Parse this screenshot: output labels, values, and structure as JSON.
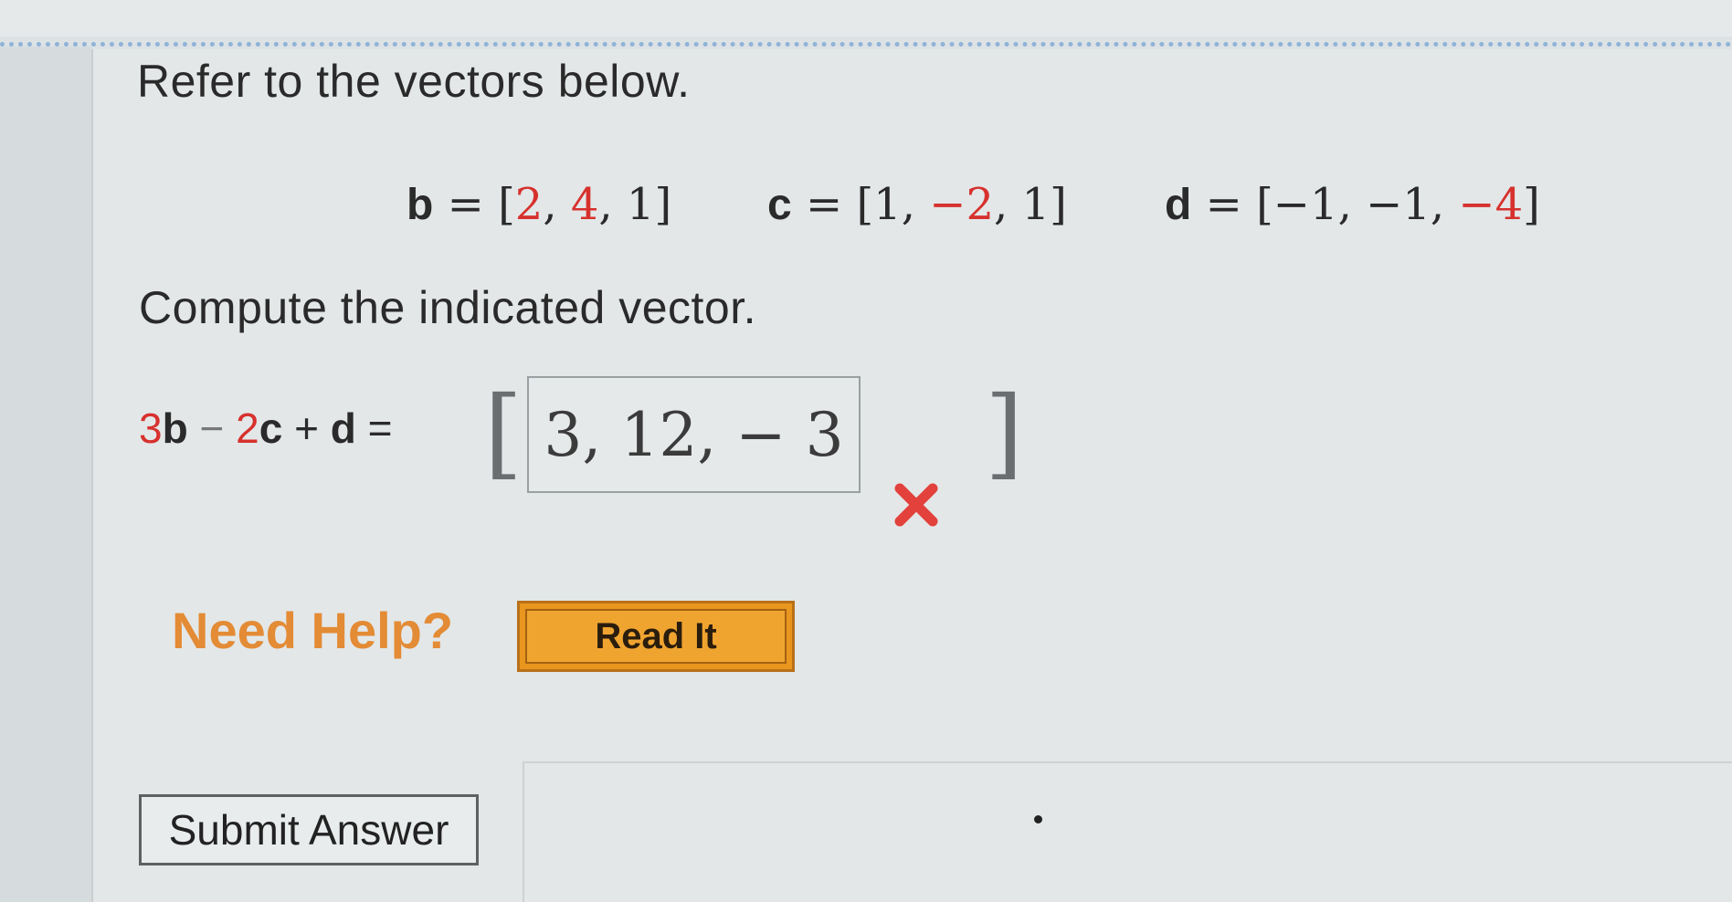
{
  "question": {
    "intro": "Refer to the vectors below.",
    "vectors": [
      {
        "name": "b",
        "values": [
          "2",
          "4",
          "1"
        ]
      },
      {
        "name": "c",
        "values": [
          "1",
          "−2",
          "1"
        ]
      },
      {
        "name": "d",
        "values": [
          "−1",
          "−1",
          "−4"
        ]
      }
    ],
    "instruction": "Compute the indicated vector.",
    "expression": {
      "coef_b": "3",
      "vec_b": "b",
      "op1": "−",
      "coef_c": "2",
      "vec_c": "c",
      "op2": "+",
      "vec_d": "d",
      "equals": "="
    },
    "answer_value": "3, 12, − 3",
    "answer_status": "incorrect",
    "bracket_open": "[",
    "bracket_close": "]"
  },
  "help": {
    "label": "Need Help?",
    "read_button": "Read It"
  },
  "submit_label": "Submit Answer",
  "colors": {
    "accent_red": "#d7312d",
    "help_orange": "#e38b35",
    "button_orange": "#f0a430"
  },
  "icons": {
    "wrong": "close-x-icon"
  }
}
